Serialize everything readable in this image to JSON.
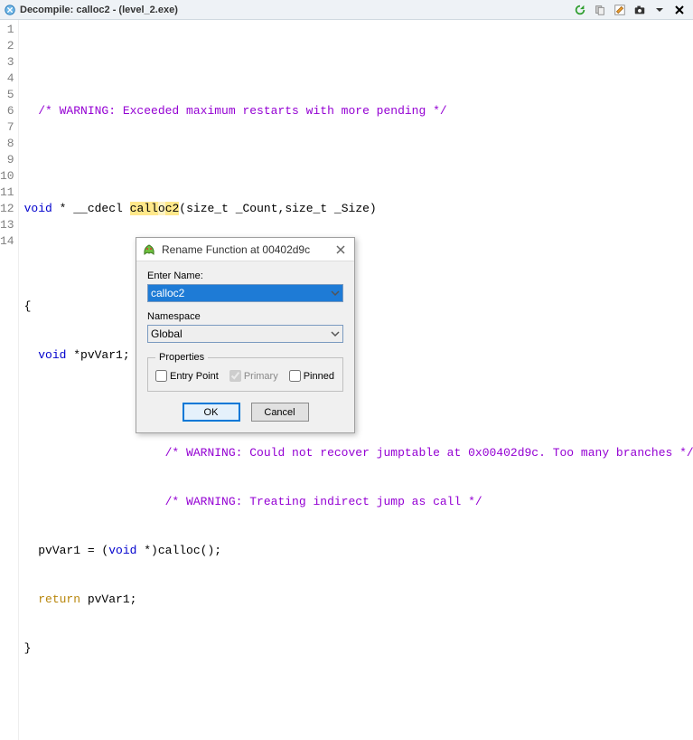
{
  "titlebar": {
    "title": "Decompile: calloc2 -  (level_2.exe)"
  },
  "gutter": [
    "1",
    "2",
    "3",
    "4",
    "5",
    "6",
    "7",
    "8",
    "9",
    "10",
    "11",
    "12",
    "13",
    "14"
  ],
  "code": {
    "l1": "",
    "l2": "  /* WARNING: Exceeded maximum restarts with more pending */",
    "l3": "",
    "l4a": "void",
    "l4b": " * __cdecl ",
    "l4c_pre": "call",
    "l4c_cur": "o",
    "l4c_post": "c2",
    "l4d": "(size_t _Count,size_t _Size)",
    "l5": "",
    "l6": "{",
    "l7a": "  void",
    "l7b": " *pvVar1;",
    "l8": "",
    "l9": "                    /* WARNING: Could not recover jumptable at 0x00402d9c. Too many branches */",
    "l10": "                    /* WARNING: Treating indirect jump as call */",
    "l11a": "  pvVar1 = (",
    "l11b": "void",
    "l11c": " *)calloc();",
    "l12a": "  return",
    "l12b": " pvVar1;",
    "l13": "}",
    "l14": ""
  },
  "dialog": {
    "title": "Rename Function at 00402d9c",
    "enter_name_label": "Enter Name:",
    "enter_name_value": "calloc2",
    "namespace_label": "Namespace",
    "namespace_value": "Global",
    "properties_legend": "Properties",
    "entry_point_label": "Entry Point",
    "primary_label": "Primary",
    "pinned_label": "Pinned",
    "ok_label": "OK",
    "cancel_label": "Cancel"
  }
}
